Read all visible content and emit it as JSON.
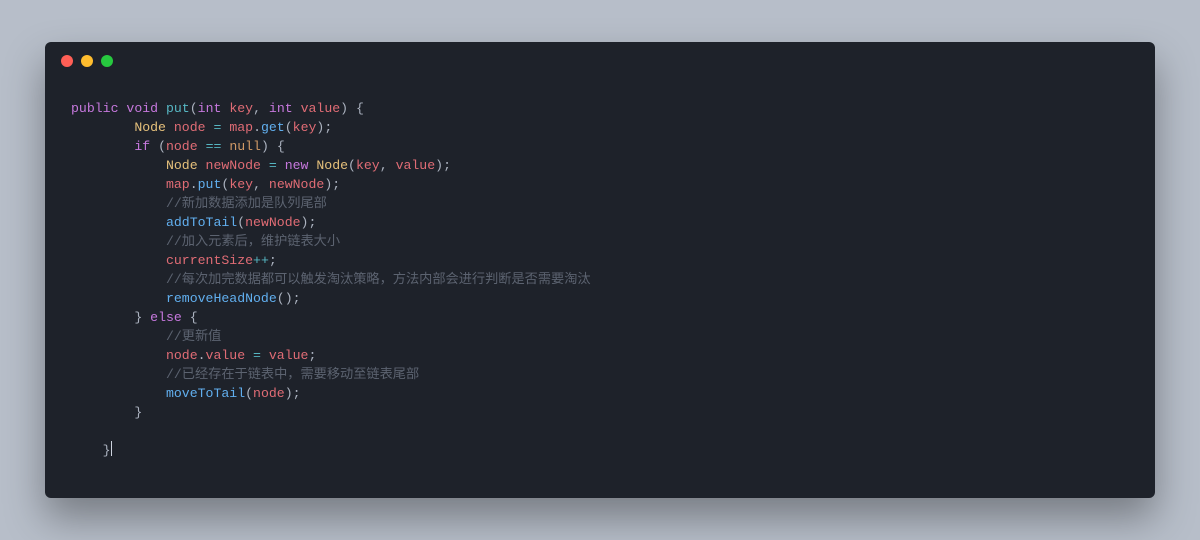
{
  "traffic": {
    "close": "close",
    "min": "minimize",
    "max": "maximize"
  },
  "tok": {
    "public": "public",
    "void": "void",
    "put": "put",
    "int": "int",
    "key": "key",
    "value": "value",
    "Node": "Node",
    "node": "node",
    "map": "map",
    "get": "get",
    "if": "if",
    "null": "null",
    "newNode": "newNode",
    "new": "new",
    "c1": "//新加数据添加是队列尾部",
    "addToTail": "addToTail",
    "c2": "//加入元素后，维护链表大小",
    "currentSize": "currentSize",
    "pp": "++",
    "c3": "//每次加完数据都可以触发淘汰策略，方法内部会进行判断是否需要淘汰",
    "removeHeadNode": "removeHeadNode",
    "else": "else",
    "c4": "//更新值",
    "c5": "//已经存在于链表中，需要移动至链表尾部",
    "moveToTail": "moveToTail"
  },
  "p": {
    "lb": "{",
    "rb": "}",
    "lp": "(",
    "rp": ")",
    "c": ",",
    "sc": ";",
    "dot": ".",
    "eq": "=",
    "eqeq": "=="
  }
}
